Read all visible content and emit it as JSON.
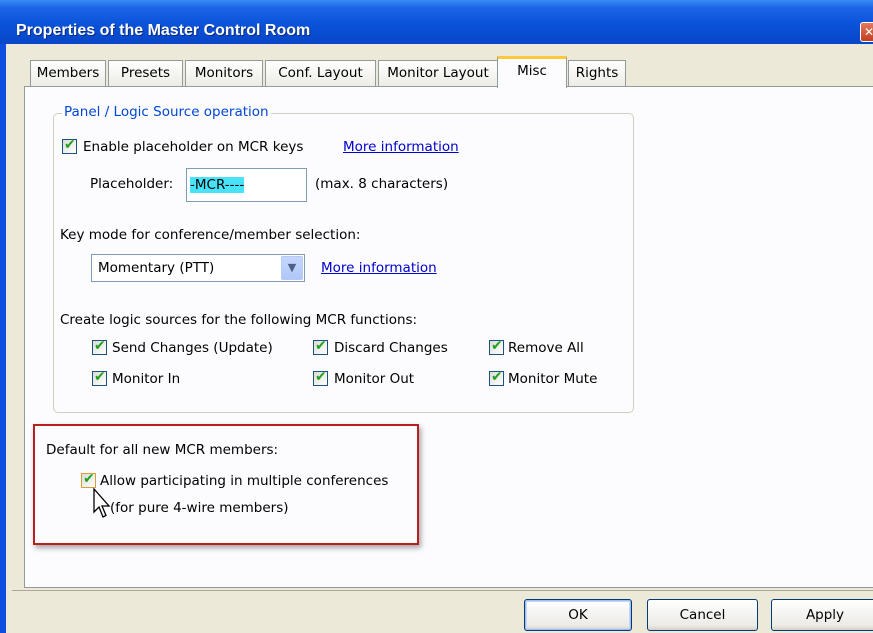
{
  "window": {
    "title": "Properties of the Master Control Room",
    "close_glyph": "✕"
  },
  "tabs": [
    {
      "label": "Members",
      "active": false
    },
    {
      "label": "Presets",
      "active": false
    },
    {
      "label": "Monitors",
      "active": false
    },
    {
      "label": "Conf. Layout",
      "active": false
    },
    {
      "label": "Monitor Layout",
      "active": false
    },
    {
      "label": "Misc",
      "active": true
    },
    {
      "label": "Rights",
      "active": false
    }
  ],
  "panel_logic": {
    "group_title": "Panel / Logic Source operation",
    "enable_placeholder": {
      "label": "Enable placeholder on MCR keys",
      "checked": true
    },
    "more_info_1": "More information",
    "placeholder_label": "Placeholder:",
    "placeholder_value": "-MCR----",
    "placeholder_hint": "(max. 8 characters)",
    "key_mode_label": "Key mode for conference/member selection:",
    "key_mode_value": "Momentary (PTT)",
    "more_info_2": "More information",
    "functions_label": "Create logic sources for the following MCR functions:",
    "functions": [
      {
        "label": "Send Changes (Update)",
        "checked": true
      },
      {
        "label": "Discard Changes",
        "checked": true
      },
      {
        "label": "Remove All",
        "checked": true
      },
      {
        "label": "Monitor In",
        "checked": true
      },
      {
        "label": "Monitor Out",
        "checked": true
      },
      {
        "label": "Monitor Mute",
        "checked": true
      }
    ]
  },
  "defaults": {
    "label": "Default for all new MCR members:",
    "allow_multi": {
      "label": "Allow participating in multiple conferences",
      "checked": true
    },
    "note": "(for pure 4-wire members)"
  },
  "buttons": {
    "ok": "OK",
    "cancel": "Cancel",
    "apply": "Apply"
  },
  "colors": {
    "title_bar": "#0a52d8",
    "link": "#0000cc",
    "highlight_box": "#b82020",
    "check": "#21a121",
    "selection": "#48e3f8"
  }
}
